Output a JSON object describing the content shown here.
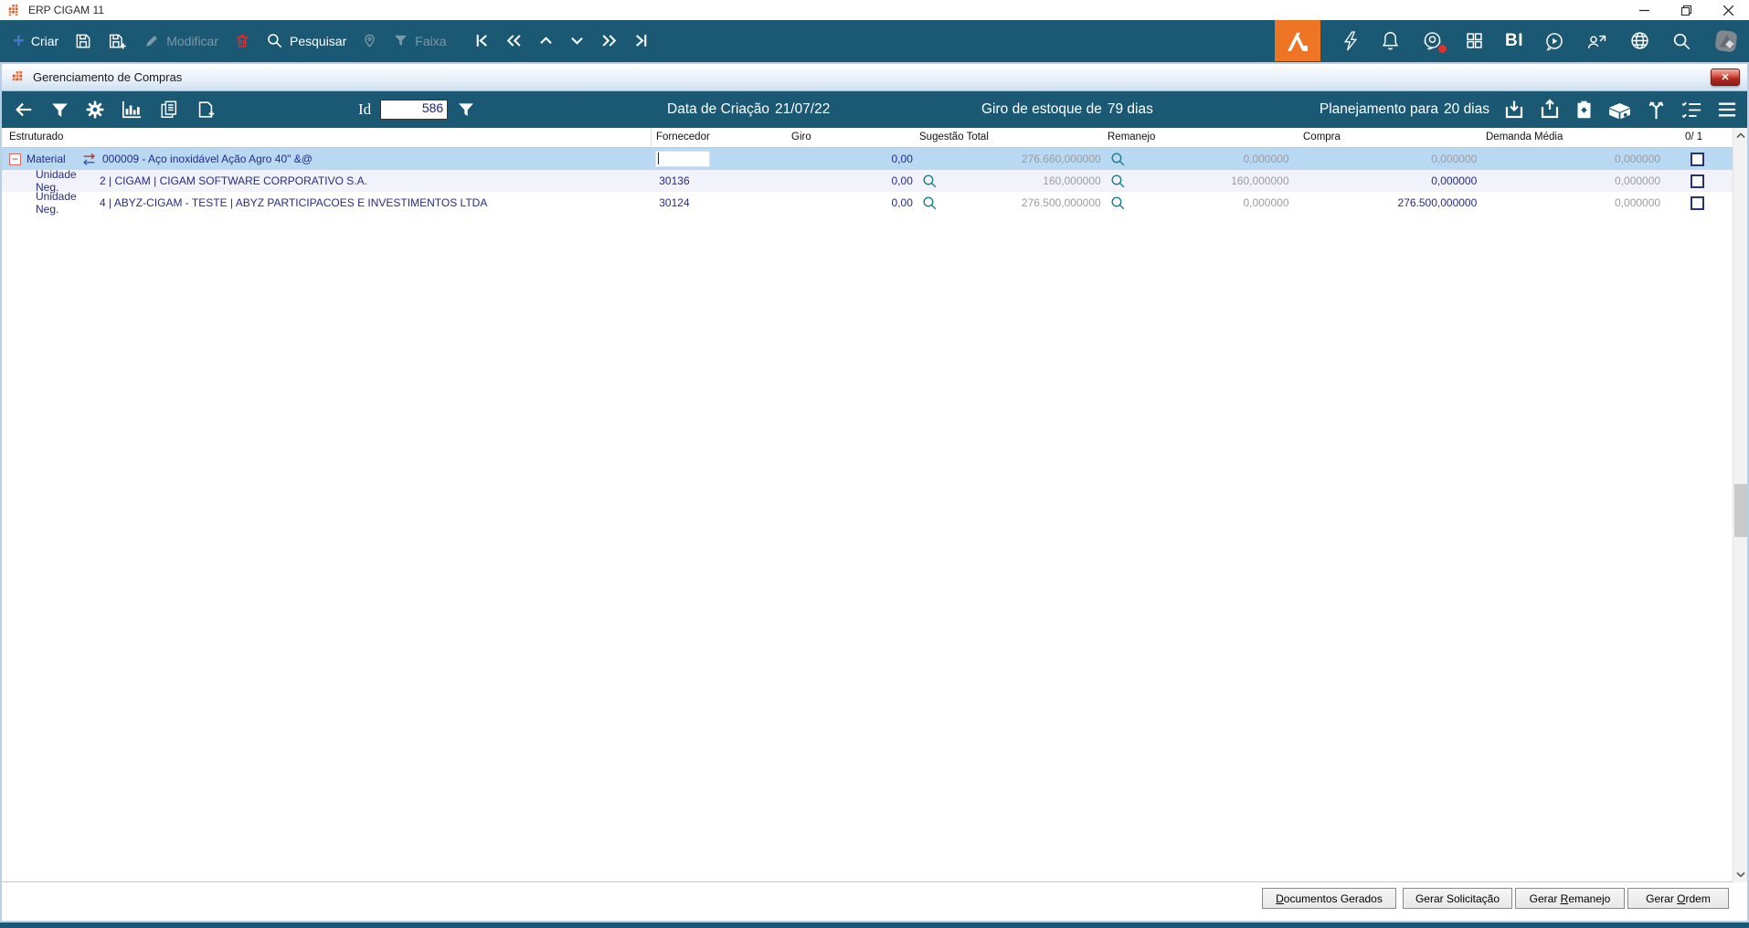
{
  "colors": {
    "teal": "#1A5873",
    "accent_orange": "#EE7523",
    "selection_blue": "#B9D8F1",
    "text_navy": "#272C85",
    "dim_value": "#9C9CA3",
    "magnifier_teal": "#1B7F92"
  },
  "os_window": {
    "title": "ERP CIGAM 11"
  },
  "main_toolbar": {
    "criar": "Criar",
    "modificar": "Modificar",
    "pesquisar": "Pesquisar",
    "faixa": "Faixa",
    "bi": "BI",
    "left_icons": [
      "plus-icon",
      "save-icon",
      "save-plus-icon",
      "pencil-icon",
      "trash-icon",
      "search-icon",
      "map-pin-icon",
      "filter-icon",
      "nav-first-icon",
      "nav-prev-icon",
      "nav-up-icon",
      "nav-down-icon",
      "nav-next-icon",
      "nav-last-icon"
    ],
    "right_icons": [
      "cigam-home-icon",
      "lightning-icon",
      "bell-icon",
      "headset-icon",
      "grid-icon",
      "bi-label",
      "play-bubble-icon",
      "user-share-icon",
      "globe-icon",
      "search-icon",
      "cigam-gray-icon"
    ]
  },
  "inner_window": {
    "title": "Gerenciamento de Compras",
    "toolbar": {
      "left_icons": [
        "back-arrow-icon",
        "filter-icon",
        "gear-icon",
        "bar-chart-icon",
        "copy-docs-icon",
        "doc-plus-icon"
      ],
      "id_label": "Id",
      "id_value": "586",
      "creation_label": "Data de Criação",
      "creation_value": "21/07/22",
      "giro_label": "Giro de estoque de",
      "giro_value": "79 dias",
      "plan_label": "Planejamento para",
      "plan_value": "20 dias",
      "right_icons": [
        "box-download-icon",
        "box-upload-icon",
        "clipboard-icon",
        "package-icon",
        "split-arrows-icon",
        "checklist-icon",
        "menu-icon"
      ]
    }
  },
  "grid": {
    "columns": [
      "Estruturado",
      "Fornecedor",
      "Giro",
      "Sugestão Total",
      "Remanejo",
      "Compra",
      "Demanda Média",
      "0/ 1"
    ],
    "rows": [
      {
        "level": 0,
        "selected": true,
        "type": "Material",
        "desc": "000009 - Aço inoxidável Ação Agro 40\" &@",
        "fornecedor": "",
        "editor": true,
        "giro": {
          "v": "0,00",
          "mag": false,
          "dim": false
        },
        "sugestao": {
          "v": "276.660,000000",
          "mag": true,
          "dim": true
        },
        "remanejo": {
          "v": "0,000000",
          "dim": true
        },
        "compra": {
          "v": "0,000000",
          "dim": true
        },
        "demanda": {
          "v": "0,000000",
          "dim": true
        },
        "checked": false
      },
      {
        "level": 1,
        "selected": false,
        "type": "Unidade Neg.",
        "desc": "2 | CIGAM | CIGAM SOFTWARE CORPORATIVO S.A.",
        "fornecedor": "30136",
        "editor": false,
        "giro": {
          "v": "0,00",
          "mag": true,
          "dim": false
        },
        "sugestao": {
          "v": "160,000000",
          "mag": true,
          "dim": true
        },
        "remanejo": {
          "v": "160,000000",
          "dim": true
        },
        "compra": {
          "v": "0,000000",
          "dim": false
        },
        "demanda": {
          "v": "0,000000",
          "dim": true
        },
        "checked": false
      },
      {
        "level": 1,
        "selected": false,
        "type": "Unidade Neg.",
        "desc": "4 | ABYZ-CIGAM - TESTE | ABYZ PARTICIPACOES E INVESTIMENTOS LTDA",
        "fornecedor": "30124",
        "editor": false,
        "giro": {
          "v": "0,00",
          "mag": true,
          "dim": false
        },
        "sugestao": {
          "v": "276.500,000000",
          "mag": true,
          "dim": true
        },
        "remanejo": {
          "v": "0,000000",
          "dim": true
        },
        "compra": {
          "v": "276.500,000000",
          "dim": false
        },
        "demanda": {
          "v": "0,000000",
          "dim": true
        },
        "checked": false
      }
    ]
  },
  "footer": {
    "buttons": [
      {
        "pre": "",
        "key": "D",
        "post": "ocumentos Gerados"
      },
      {
        "pre": "Gerar Solicitação",
        "key": "",
        "post": ""
      },
      {
        "pre": "Gerar ",
        "key": "R",
        "post": "emanejo"
      },
      {
        "pre": "Gerar ",
        "key": "O",
        "post": "rdem"
      }
    ]
  }
}
